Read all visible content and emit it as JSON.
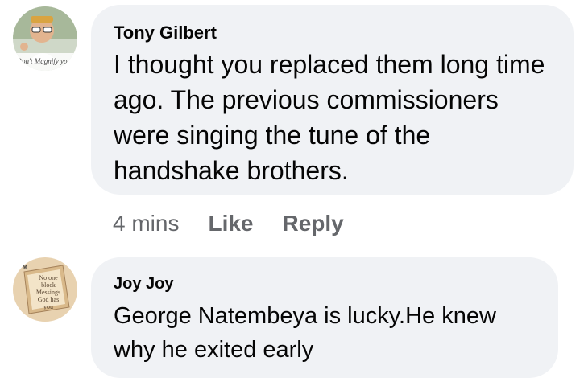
{
  "comments": [
    {
      "author": "Tony Gilbert",
      "lines": [
        "I thought you replaced them long time",
        "ago. The previous commissioners",
        "were singing the tune of the",
        "handshake brothers."
      ],
      "avatar_caption": "Don't Magnify your",
      "time": "4 mins",
      "like_label": "Like",
      "reply_label": "Reply"
    },
    {
      "author": "Joy Joy",
      "lines": [
        "George Natembeya is lucky.He knew",
        "why he exited early"
      ],
      "avatar_text": [
        "No one",
        "block",
        "Messings",
        "God has",
        "you"
      ]
    }
  ],
  "colors": {
    "bubble": "#f0f2f5",
    "text": "#050505",
    "secondary": "#65676b"
  }
}
